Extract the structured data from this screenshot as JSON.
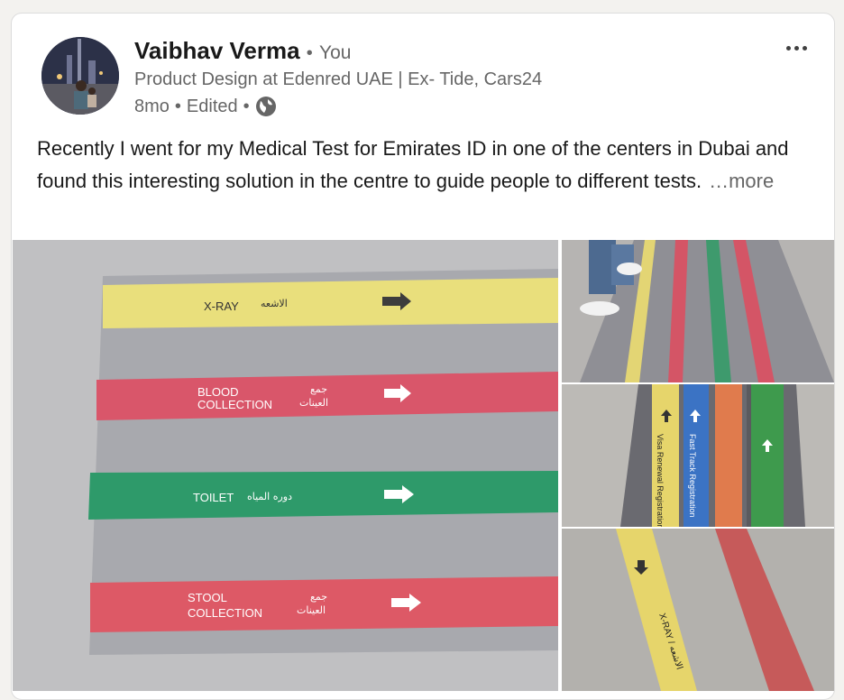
{
  "post": {
    "author": "Vaibhav Verma",
    "separator": "•",
    "relation": "You",
    "headline": "Product Design at Edenred UAE | Ex- Tide, Cars24",
    "time": "8mo",
    "edited": "Edited",
    "text": "Recently I went for my Medical Test for Emirates ID in one of the centers in Dubai and found this interesting solution in the centre to guide people to different tests.",
    "see_more": "…more"
  },
  "photo_main": {
    "stripes": [
      {
        "label_en": "X-RAY",
        "label_ar": "الاشعه",
        "color": "#e9df7c"
      },
      {
        "label_en": "BLOOD\nCOLLECTION",
        "label_ar": "جمع\nالعينات",
        "color": "#d9566a"
      },
      {
        "label_en": "TOILET",
        "label_ar": "دوره المياه",
        "color": "#2e9a6a"
      },
      {
        "label_en": "STOOL\nCOLLECTION",
        "label_ar": "جمع\nالعينات",
        "color": "#dd5966"
      }
    ],
    "floor_color": "#c2c2c4",
    "mat_color": "#a7a8ad"
  },
  "photo_side_2": {
    "labels": [
      "Visa Renewal Registration",
      "Fast Track Registration"
    ]
  },
  "photo_side_3": {
    "label": "X-RAY / الاشعه"
  },
  "icons": [
    "more-options-icon",
    "globe-icon",
    "right-arrow-icon"
  ]
}
